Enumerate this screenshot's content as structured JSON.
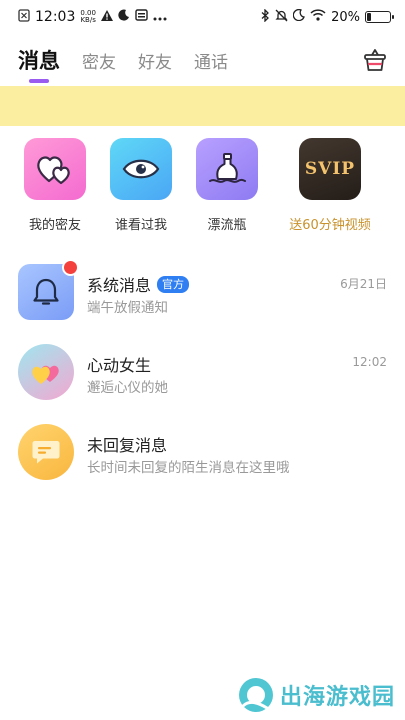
{
  "status_bar": {
    "time": "12:03",
    "net_speed_value": "0.00",
    "net_speed_unit": "KB/s",
    "battery": "20%",
    "battery_level": 0.2,
    "icons": [
      "notification-icon",
      "warning-icon",
      "moon-icon",
      "card-icon",
      "more-dots-icon",
      "bluetooth-icon",
      "mute-bell-icon",
      "moon-icon",
      "wifi-icon",
      "battery-icon"
    ]
  },
  "tabs": [
    {
      "label": "消息",
      "active": true
    },
    {
      "label": "密友",
      "active": false
    },
    {
      "label": "好友",
      "active": false
    },
    {
      "label": "通话",
      "active": false
    }
  ],
  "quick_entries": [
    {
      "label": "我的密友",
      "icon": "hearts-icon"
    },
    {
      "label": "谁看过我",
      "icon": "eye-icon"
    },
    {
      "label": "漂流瓶",
      "icon": "bottle-icon"
    },
    {
      "label": "送60分钟视频",
      "icon": "svip-icon",
      "icon_text": "SVIP"
    }
  ],
  "messages": [
    {
      "title": "系统消息",
      "badge": "官方",
      "subtitle": "端午放假通知",
      "time": "6月21日",
      "unread": true
    },
    {
      "title": "心动女生",
      "subtitle": "邂逅心仪的她",
      "time": "12:02"
    },
    {
      "title": "未回复消息",
      "subtitle": "长时间未回复的陌生消息在这里哦",
      "time": ""
    }
  ],
  "watermark": {
    "text": "出海游戏园"
  },
  "colors": {
    "accent": "#9a5cf0",
    "notice_bar": "#fbeea0",
    "gold": "#c9922c",
    "badge": "#2f7ff2",
    "unread_dot": "#f4413e"
  }
}
